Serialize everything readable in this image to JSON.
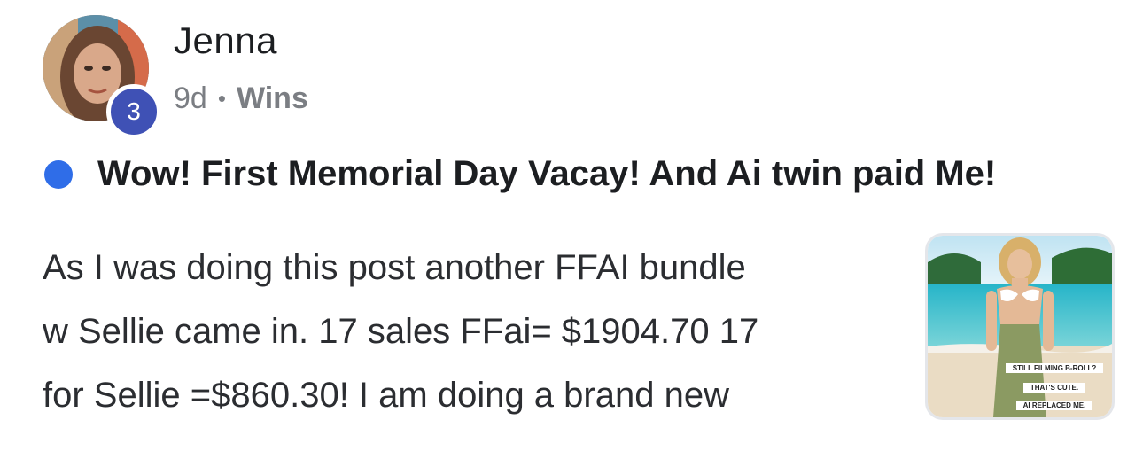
{
  "author": {
    "name": "Jenna",
    "level": "3"
  },
  "meta": {
    "time": "9d",
    "separator": "•",
    "category": "Wins"
  },
  "post": {
    "title": "Wow! First Memorial Day Vacay! And Ai twin paid Me!",
    "body_lines": [
      "As I was doing this post another FFAI bundle",
      "w Sellie came in. 17 sales FFai= $1904.70 17",
      "for Sellie =$860.30! I am doing a brand new"
    ]
  },
  "thumbnail": {
    "captions": [
      "STILL FILMING B-ROLL?",
      "THAT'S CUTE.",
      "AI REPLACED ME."
    ]
  },
  "colors": {
    "unread": "#2f6de8",
    "badge": "#3f51b5",
    "meta": "#7b7e83"
  }
}
